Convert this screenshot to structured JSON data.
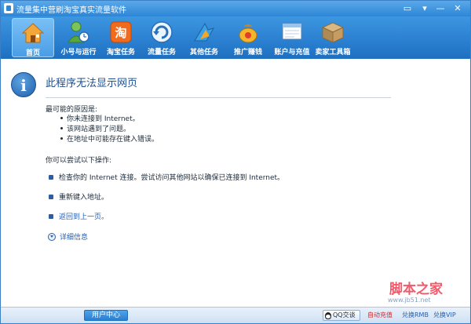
{
  "window": {
    "title": "流量集中营刷淘宝真实流量软件",
    "min_label": "—",
    "close_label": "✕",
    "menu_label": "▾",
    "skin_label": "▭"
  },
  "toolbar": {
    "items": [
      {
        "label": "首页",
        "icon": "home-icon"
      },
      {
        "label": "小号与运行",
        "icon": "user-clock-icon"
      },
      {
        "label": "淘宝任务",
        "icon": "taobao-icon"
      },
      {
        "label": "流量任务",
        "icon": "refresh-icon"
      },
      {
        "label": "其他任务",
        "icon": "arrow-icon"
      },
      {
        "label": "推广赚钱",
        "icon": "money-bag-icon"
      },
      {
        "label": "账户与充值",
        "icon": "account-window-icon"
      },
      {
        "label": "卖家工具箱",
        "icon": "toolbox-icon"
      }
    ],
    "taobao_glyph": "淘"
  },
  "error_page": {
    "heading": "此程序无法显示网页",
    "causes_title": "最可能的原因是:",
    "causes": [
      "你未连接到 Internet。",
      "该网站遇到了问题。",
      "在地址中可能存在键入错误。"
    ],
    "try_title": "你可以尝试以下操作:",
    "actions": [
      "检查你的 Internet 连接。尝试访问其他网站以确保已连接到 Internet。",
      "重新键入地址。",
      "返回到上一页。"
    ],
    "more_info": "详细信息",
    "info_glyph": "i"
  },
  "watermark": {
    "line1": "脚本之家",
    "line2": "www.jb51.net"
  },
  "statusbar": {
    "user_center": "用户中心",
    "qq_chat": "QQ交谈",
    "recharge": "自动充值",
    "rmb": "兑换RMB",
    "vip": "兑换VIP"
  },
  "colors": {
    "title_blue": "#2d86d6",
    "heading_blue": "#1f4e8c",
    "recharge_red": "#d42a2a",
    "link_blue": "#1f5fb8"
  }
}
